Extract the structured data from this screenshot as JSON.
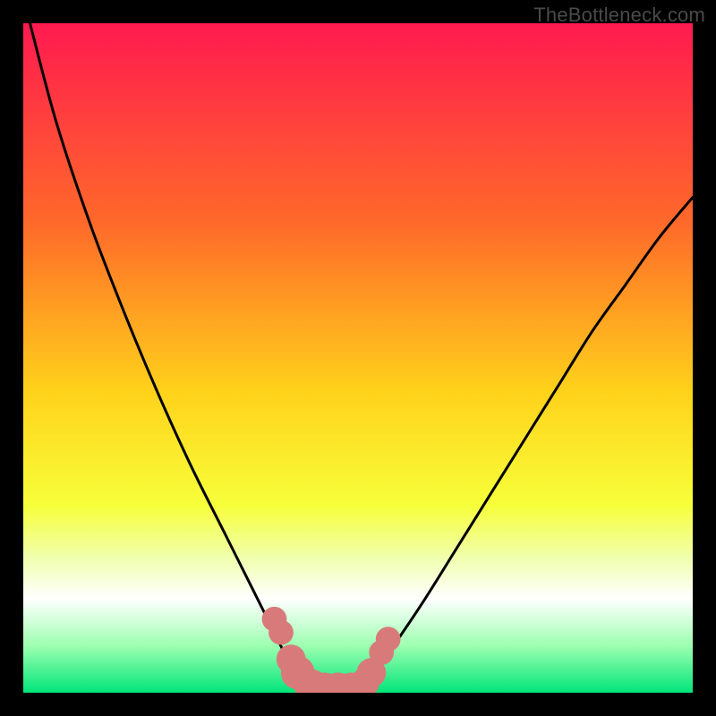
{
  "watermark": "TheBottleneck.com",
  "chart_data": {
    "type": "line",
    "title": "",
    "xlabel": "",
    "ylabel": "",
    "xlim": [
      0,
      100
    ],
    "ylim": [
      0,
      100
    ],
    "gradient_stops": [
      {
        "offset": 0,
        "color": "#ff1a4f"
      },
      {
        "offset": 30,
        "color": "#ff6a2a"
      },
      {
        "offset": 55,
        "color": "#ffd21a"
      },
      {
        "offset": 72,
        "color": "#f7ff3a"
      },
      {
        "offset": 80,
        "color": "#f0ffb0"
      },
      {
        "offset": 86,
        "color": "#ffffff"
      },
      {
        "offset": 93,
        "color": "#9dffb0"
      },
      {
        "offset": 100,
        "color": "#00e57a"
      }
    ],
    "series": [
      {
        "name": "left-curve",
        "points": [
          {
            "x": 1,
            "y": 100
          },
          {
            "x": 5,
            "y": 85
          },
          {
            "x": 10,
            "y": 70
          },
          {
            "x": 15,
            "y": 57
          },
          {
            "x": 20,
            "y": 45
          },
          {
            "x": 25,
            "y": 34
          },
          {
            "x": 30,
            "y": 24
          },
          {
            "x": 33,
            "y": 18
          },
          {
            "x": 35,
            "y": 14
          },
          {
            "x": 37,
            "y": 10
          },
          {
            "x": 39,
            "y": 6
          },
          {
            "x": 41,
            "y": 3
          },
          {
            "x": 43,
            "y": 1
          },
          {
            "x": 44,
            "y": 0
          }
        ]
      },
      {
        "name": "right-curve",
        "points": [
          {
            "x": 50,
            "y": 0
          },
          {
            "x": 52,
            "y": 2
          },
          {
            "x": 54,
            "y": 5
          },
          {
            "x": 56,
            "y": 8
          },
          {
            "x": 60,
            "y": 14
          },
          {
            "x": 65,
            "y": 22
          },
          {
            "x": 70,
            "y": 30
          },
          {
            "x": 75,
            "y": 38
          },
          {
            "x": 80,
            "y": 46
          },
          {
            "x": 85,
            "y": 54
          },
          {
            "x": 90,
            "y": 61
          },
          {
            "x": 95,
            "y": 68
          },
          {
            "x": 100,
            "y": 74
          }
        ]
      }
    ],
    "markers": [
      {
        "x": 37.5,
        "y": 11,
        "r": 1.2
      },
      {
        "x": 38.5,
        "y": 9,
        "r": 1.2
      },
      {
        "x": 40,
        "y": 5,
        "r": 1.5
      },
      {
        "x": 41,
        "y": 3,
        "r": 1.8
      },
      {
        "x": 43,
        "y": 1,
        "r": 1.8
      },
      {
        "x": 45,
        "y": 0.5,
        "r": 1.8
      },
      {
        "x": 47,
        "y": 0.5,
        "r": 1.8
      },
      {
        "x": 49,
        "y": 0.5,
        "r": 1.8
      },
      {
        "x": 51,
        "y": 1.5,
        "r": 1.5
      },
      {
        "x": 52,
        "y": 3,
        "r": 1.5
      },
      {
        "x": 53.5,
        "y": 6,
        "r": 1.2
      },
      {
        "x": 54.5,
        "y": 8,
        "r": 1.2
      }
    ],
    "marker_color": "#d97a7a"
  }
}
